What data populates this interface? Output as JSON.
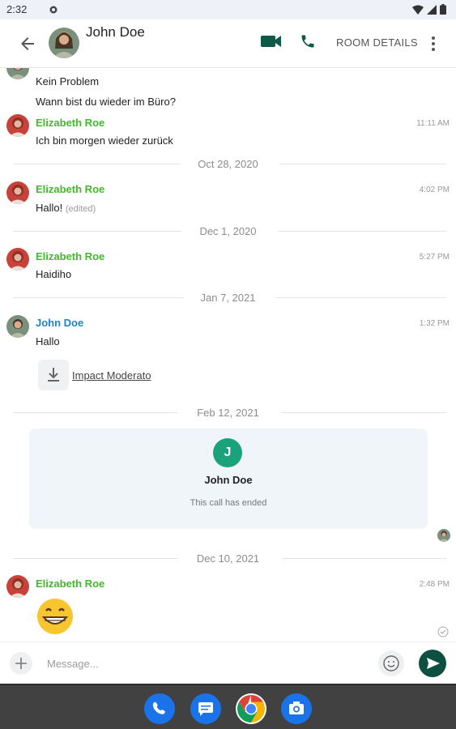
{
  "status_bar": {
    "time": "2:32",
    "icons": [
      "notification-icon",
      "wifi-icon",
      "signal-icon",
      "battery-icon"
    ]
  },
  "header": {
    "title": "John Doe",
    "room_details_label": "ROOM DETAILS",
    "icons": [
      "back-arrow-icon",
      "video-call-icon",
      "phone-icon",
      "more-vert-icon"
    ]
  },
  "timeline": {
    "messages": [
      {
        "text": "Kein Problem"
      },
      {
        "text": "Wann bist du wieder im Büro?"
      },
      {
        "sender": "Elizabeth Roe",
        "time": "11:11 AM",
        "text": "Ich bin morgen wieder zurück"
      }
    ],
    "dates": [
      "Oct 28, 2020",
      "Dec 1, 2020",
      "Jan 7, 2021",
      "Feb 12, 2021",
      "Dec 10, 2021"
    ],
    "group_oct": {
      "sender": "Elizabeth Roe",
      "time": "4:02 PM",
      "text": "Hallo!",
      "edited": "(edited)"
    },
    "group_dec": {
      "sender": "Elizabeth Roe",
      "time": "5:27 PM",
      "text": "Haidiho"
    },
    "group_jan": {
      "sender": "John Doe",
      "time": "1:32 PM",
      "text": "Hallo",
      "file_name": "Impact Moderato"
    },
    "call": {
      "avatar_letter": "J",
      "name": "John Doe",
      "status": "This call has ended"
    },
    "group_dec2021": {
      "sender": "Elizabeth Roe",
      "time": "2:48 PM",
      "emoji": "grinning-face-emoji"
    }
  },
  "composer": {
    "placeholder": "Message..."
  },
  "colors": {
    "sender_green": "#42b82b",
    "sender_blue": "#1f83c7",
    "accent_dark_teal": "#0d4f40",
    "call_avatar": "#1aa37a"
  }
}
